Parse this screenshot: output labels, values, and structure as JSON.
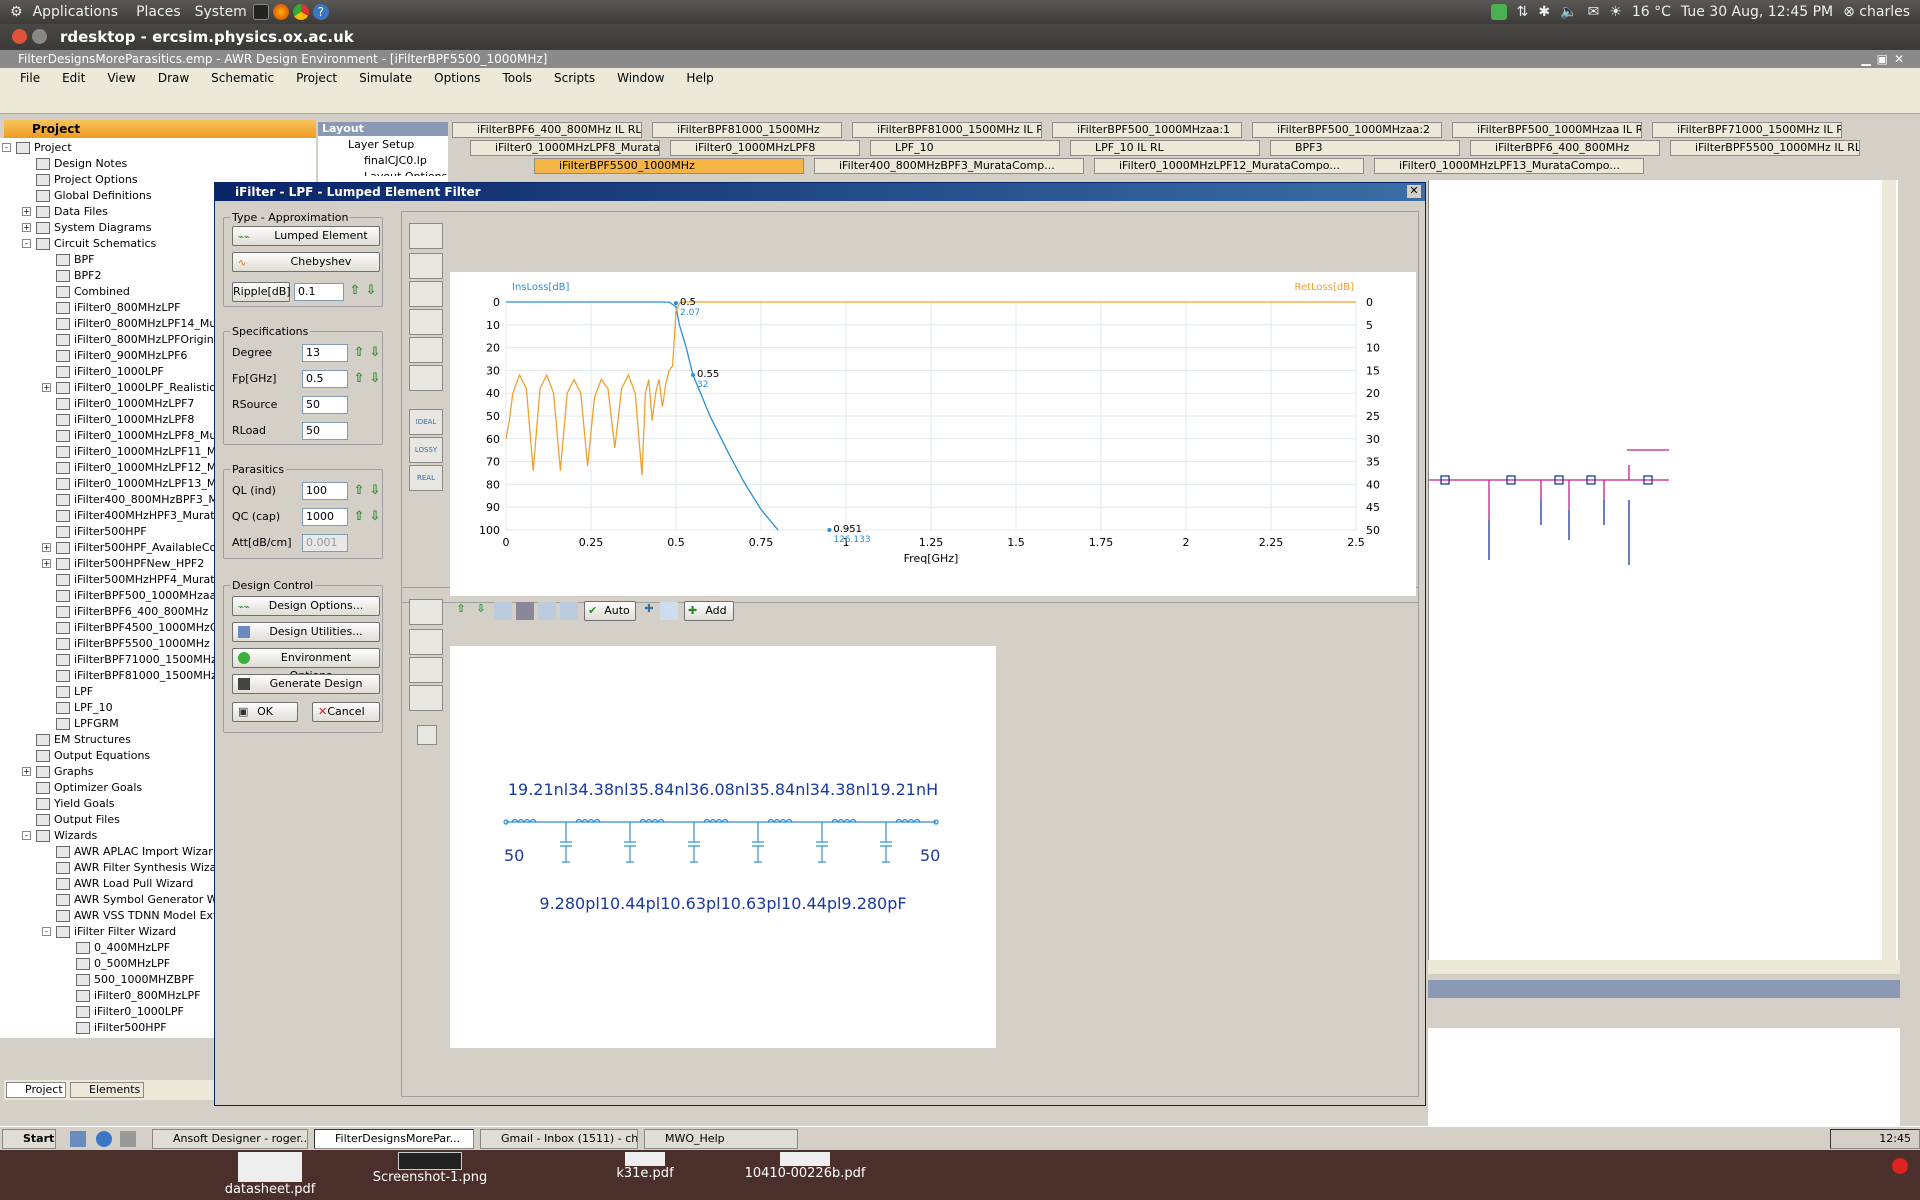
{
  "top_panel": {
    "menus": [
      "Applications",
      "Places",
      "System"
    ],
    "temperature": "16 °C",
    "datetime": "Tue 30 Aug, 12:45 PM",
    "user": "charles"
  },
  "rdesktop_title": "rdesktop - ercsim.physics.ox.ac.uk",
  "awr": {
    "title": "FilterDesignsMoreParasitics.emp - AWR Design Environment - [iFilterBPF5500_1000MHz]",
    "menu": [
      "File",
      "Edit",
      "View",
      "Draw",
      "Schematic",
      "Project",
      "Simulate",
      "Options",
      "Tools",
      "Scripts",
      "Window",
      "Help"
    ]
  },
  "project": {
    "header": "Project",
    "items": [
      {
        "label": "Project",
        "level": 0,
        "exp": "-"
      },
      {
        "label": "Design Notes",
        "level": 1,
        "exp": ""
      },
      {
        "label": "Project Options",
        "level": 1,
        "exp": ""
      },
      {
        "label": "Global Definitions",
        "level": 1,
        "exp": ""
      },
      {
        "label": "Data Files",
        "level": 1,
        "exp": "+"
      },
      {
        "label": "System Diagrams",
        "level": 1,
        "exp": "+"
      },
      {
        "label": "Circuit Schematics",
        "level": 1,
        "exp": "-"
      },
      {
        "label": "BPF",
        "level": 2,
        "exp": ""
      },
      {
        "label": "BPF2",
        "level": 2,
        "exp": ""
      },
      {
        "label": "Combined",
        "level": 2,
        "exp": ""
      },
      {
        "label": "iFilter0_800MHzLPF",
        "level": 2,
        "exp": ""
      },
      {
        "label": "iFilter0_800MHzLPF14_Mu",
        "level": 2,
        "exp": ""
      },
      {
        "label": "iFilter0_800MHzLPFOrigina",
        "level": 2,
        "exp": ""
      },
      {
        "label": "iFilter0_900MHzLPF6",
        "level": 2,
        "exp": ""
      },
      {
        "label": "iFilter0_1000LPF",
        "level": 2,
        "exp": ""
      },
      {
        "label": "iFilter0_1000LPF_Realistic",
        "level": 2,
        "exp": "+"
      },
      {
        "label": "iFilter0_1000MHzLPF7",
        "level": 2,
        "exp": ""
      },
      {
        "label": "iFilter0_1000MHzLPF8",
        "level": 2,
        "exp": ""
      },
      {
        "label": "iFilter0_1000MHzLPF8_Mu",
        "level": 2,
        "exp": ""
      },
      {
        "label": "iFilter0_1000MHzLPF11_M",
        "level": 2,
        "exp": ""
      },
      {
        "label": "iFilter0_1000MHzLPF12_M",
        "level": 2,
        "exp": ""
      },
      {
        "label": "iFilter0_1000MHzLPF13_M",
        "level": 2,
        "exp": ""
      },
      {
        "label": "iFilter400_800MHzBPF3_M",
        "level": 2,
        "exp": ""
      },
      {
        "label": "iFilter400MHzHPF3_Murat",
        "level": 2,
        "exp": ""
      },
      {
        "label": "iFilter500HPF",
        "level": 2,
        "exp": ""
      },
      {
        "label": "iFilter500HPF_AvailableCo",
        "level": 2,
        "exp": "+"
      },
      {
        "label": "iFilter500HPFNew_HPF2",
        "level": 2,
        "exp": "+"
      },
      {
        "label": "iFilter500MHzHPF4_Murat",
        "level": 2,
        "exp": ""
      },
      {
        "label": "iFilterBPF500_1000MHzaa",
        "level": 2,
        "exp": ""
      },
      {
        "label": "iFilterBPF6_400_800MHz",
        "level": 2,
        "exp": ""
      },
      {
        "label": "iFilterBPF4500_1000MHzC",
        "level": 2,
        "exp": ""
      },
      {
        "label": "iFilterBPF5500_1000MHz",
        "level": 2,
        "exp": ""
      },
      {
        "label": "iFilterBPF71000_1500MHz",
        "level": 2,
        "exp": ""
      },
      {
        "label": "iFilterBPF81000_1500MHz",
        "level": 2,
        "exp": ""
      },
      {
        "label": "LPF",
        "level": 2,
        "exp": ""
      },
      {
        "label": "LPF_10",
        "level": 2,
        "exp": ""
      },
      {
        "label": "LPFGRM",
        "level": 2,
        "exp": ""
      },
      {
        "label": "EM Structures",
        "level": 1,
        "exp": ""
      },
      {
        "label": "Output Equations",
        "level": 1,
        "exp": ""
      },
      {
        "label": "Graphs",
        "level": 1,
        "exp": "+"
      },
      {
        "label": "Optimizer Goals",
        "level": 1,
        "exp": ""
      },
      {
        "label": "Yield Goals",
        "level": 1,
        "exp": ""
      },
      {
        "label": "Output Files",
        "level": 1,
        "exp": ""
      },
      {
        "label": "Wizards",
        "level": 1,
        "exp": "-"
      },
      {
        "label": "AWR APLAC Import Wizar",
        "level": 2,
        "exp": ""
      },
      {
        "label": "AWR Filter Synthesis Wiza",
        "level": 2,
        "exp": ""
      },
      {
        "label": "AWR Load Pull Wizard",
        "level": 2,
        "exp": ""
      },
      {
        "label": "AWR Symbol Generator W",
        "level": 2,
        "exp": ""
      },
      {
        "label": "AWR VSS TDNN Model Ext",
        "level": 2,
        "exp": ""
      },
      {
        "label": "iFilter Filter Wizard",
        "level": 2,
        "exp": "-"
      },
      {
        "label": "0_400MHzLPF",
        "level": 3,
        "exp": ""
      },
      {
        "label": "0_500MHzLPF",
        "level": 3,
        "exp": ""
      },
      {
        "label": "500_1000MHZBPF",
        "level": 3,
        "exp": ""
      },
      {
        "label": "iFilter0_800MHzLPF",
        "level": 3,
        "exp": ""
      },
      {
        "label": "iFilter0_1000LPF",
        "level": 3,
        "exp": ""
      },
      {
        "label": "iFilter500HPF",
        "level": 3,
        "exp": ""
      },
      {
        "label": "iFilterBPF500_1000MH",
        "level": 3,
        "exp": ""
      },
      {
        "label": "User Folders",
        "level": 0,
        "exp": ""
      }
    ],
    "bottom_tabs": [
      "Project",
      "Elements"
    ]
  },
  "layout_panel": {
    "title": "Layout",
    "items": [
      "Layer Setup",
      "finalCJC0.lp",
      "Layout Options"
    ]
  },
  "doc_tabs": {
    "row1": [
      "iFilterBPF6_400_800MHz IL RL",
      "iFilterBPF81000_1500MHz",
      "iFilterBPF81000_1500MHz IL RL",
      "iFilterBPF500_1000MHzaa:1",
      "iFilterBPF500_1000MHzaa:2",
      "iFilterBPF500_1000MHzaa IL RL",
      "iFilterBPF71000_1500MHz IL RL"
    ],
    "row2": [
      "iFilter0_1000MHzLPF8_MurataCompo...",
      "iFilter0_1000MHzLPF8",
      "LPF_10",
      "LPF_10 IL RL",
      "BPF3",
      "iFilterBPF6_400_800MHz",
      "iFilterBPF5500_1000MHz IL RL"
    ],
    "row3": [
      "iFilterBPF5500_1000MHz",
      "iFilter400_800MHzBPF3_MurataComp...",
      "iFilter0_1000MHzLPF12_MurataCompo...",
      "iFilter0_1000MHzLPF13_MurataCompo..."
    ]
  },
  "dialog": {
    "title": "iFilter - LPF - Lumped Element Filter",
    "type_group": "Type - Approximation",
    "lumped_button": "Lumped Element",
    "chebyshev_button": "Chebyshev",
    "ripple_label": "Ripple[dB]",
    "ripple_value": "0.1",
    "spec_group": "Specifications",
    "degree_label": "Degree",
    "degree_value": "13",
    "fp_label": "Fp[GHz]",
    "fp_value": "0.5",
    "rsource_label": "RSource",
    "rsource_value": "50",
    "rload_label": "RLoad",
    "rload_value": "50",
    "parasitics_group": "Parasitics",
    "ql_label": "QL (ind)",
    "ql_value": "100",
    "qc_label": "QC (cap)",
    "qc_value": "1000",
    "att_label": "Att[dB/cm]",
    "att_value": "0.001",
    "design_group": "Design Control",
    "design_options": "Design Options...",
    "design_utilities": "Design Utilities...",
    "environment_options": "Environment Options...",
    "generate_design": "Generate Design",
    "ok": "OK",
    "cancel": "Cancel",
    "side_icons": [
      "IDEAL",
      "LOSSY",
      "REAL"
    ],
    "chart_toolbar": {
      "auto": "Auto",
      "add": "Add"
    }
  },
  "chart_data": {
    "type": "line",
    "title": "",
    "xlabel": "Freq[GHz]",
    "ylabel_left": "InsLoss[dB]",
    "ylabel_right": "RetLoss[dB]",
    "xlim": [
      0,
      2.5
    ],
    "ylim_left": [
      0,
      100
    ],
    "ylim_right": [
      0,
      50
    ],
    "x_ticks": [
      "0",
      "0.25",
      "0.5",
      "0.75",
      "1",
      "1.25",
      "1.5",
      "1.75",
      "2",
      "2.25",
      "2.5"
    ],
    "y_ticks_left": [
      "0",
      "10",
      "20",
      "30",
      "40",
      "50",
      "60",
      "70",
      "80",
      "90",
      "100"
    ],
    "y_ticks_right": [
      "0",
      "5",
      "10",
      "15",
      "20",
      "25",
      "30",
      "35",
      "40",
      "45",
      "50"
    ],
    "grid": true,
    "series": [
      {
        "name": "InsLoss[dB]",
        "color": "#2a8fd8",
        "axis": "left",
        "x": [
          0,
          0.45,
          0.48,
          0.5,
          0.51,
          0.53,
          0.55,
          0.6,
          0.65,
          0.7,
          0.75,
          0.8
        ],
        "y": [
          0,
          0,
          0.1,
          2.07,
          10,
          20,
          32,
          50,
          65,
          79,
          91,
          100
        ]
      },
      {
        "name": "RetLoss[dB]",
        "color": "#f0a030",
        "axis": "right",
        "x": [
          0.0,
          0.01,
          0.02,
          0.04,
          0.06,
          0.08,
          0.1,
          0.12,
          0.14,
          0.16,
          0.18,
          0.2,
          0.22,
          0.24,
          0.26,
          0.28,
          0.3,
          0.32,
          0.34,
          0.36,
          0.38,
          0.4,
          0.41,
          0.42,
          0.43,
          0.44,
          0.45,
          0.46,
          0.47,
          0.48,
          0.49,
          0.5,
          0.51,
          0.52,
          0.6,
          1.0,
          2.5
        ],
        "y": [
          30,
          26,
          20,
          16,
          19,
          37,
          19,
          16,
          20,
          37,
          20,
          17,
          20,
          36,
          21,
          17,
          19,
          32,
          19,
          16,
          20,
          38,
          20,
          17,
          26,
          20,
          17,
          23,
          18,
          15,
          14,
          2,
          0.3,
          0,
          0,
          0,
          0
        ]
      }
    ],
    "annotations": [
      {
        "x": 0.5,
        "y": 0.5,
        "text": "0.5",
        "sub": "2.07"
      },
      {
        "x": 0.55,
        "y": 32,
        "text": "0.55",
        "sub": "32"
      },
      {
        "x": 0.951,
        "y": 100,
        "text": "0.951",
        "sub": "126.133"
      }
    ]
  },
  "circuit": {
    "inductors": "19.21nl34.38nl35.84nl36.08nl35.84nl34.38nl19.21nH",
    "capacitors": "9.280pl10.44pl10.63pl10.63pl10.44pl9.280pF",
    "rsource": "50",
    "rload": "50"
  },
  "taskbar": {
    "start": "Start",
    "tasks": [
      "Ansoft Designer - roger...",
      "FilterDesignsMorePar...",
      "Gmail - Inbox (1511) - ch...",
      "MWO_Help"
    ],
    "clock": "12:45"
  },
  "desktop_files": [
    "datasheet.pdf",
    "Screenshot-1.png",
    "k31e.pdf",
    "10410-00226b.pdf"
  ]
}
